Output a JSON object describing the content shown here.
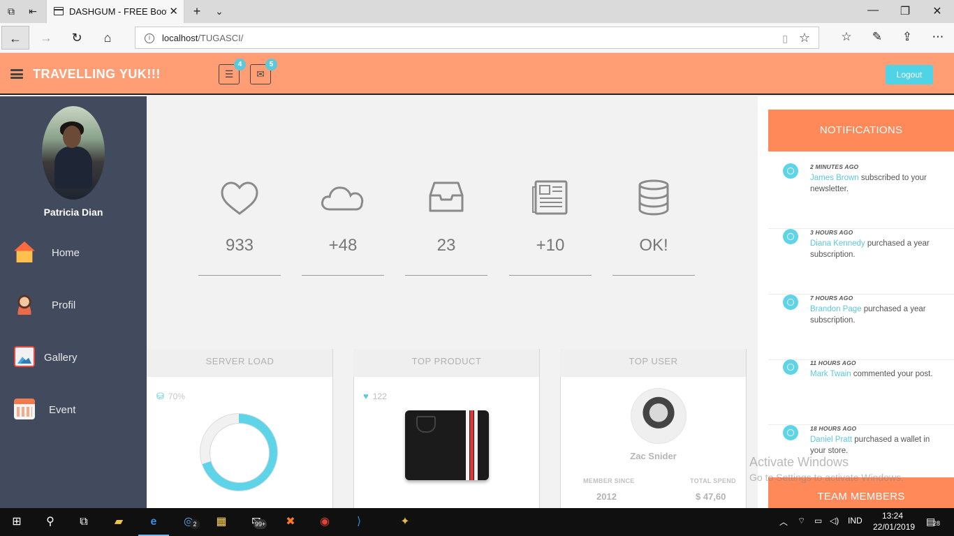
{
  "browser": {
    "tab_title": "DASHGUM - FREE Boot:",
    "url_host": "localhost",
    "url_path": "/TUGASCI/"
  },
  "header": {
    "brand": "TRAVELLING YUK!!!",
    "tasks_badge": "4",
    "mail_badge": "5",
    "logout_label": "Logout"
  },
  "sidebar": {
    "profile_name": "Patricia Dian",
    "items": [
      {
        "label": "Home",
        "icon": "home-icon"
      },
      {
        "label": "Profil",
        "icon": "person-icon"
      },
      {
        "label": "Gallery",
        "icon": "gallery-icon"
      },
      {
        "label": "Event",
        "icon": "calendar-icon"
      }
    ]
  },
  "stats": [
    {
      "icon": "heart-icon",
      "value": "933"
    },
    {
      "icon": "cloud-icon",
      "value": "+48"
    },
    {
      "icon": "inbox-icon",
      "value": "23"
    },
    {
      "icon": "newspaper-icon",
      "value": "+10"
    },
    {
      "icon": "database-icon",
      "value": "OK!"
    }
  ],
  "panels": {
    "server_load": {
      "title": "SERVER LOAD",
      "percent_label": "70%",
      "percent_value": 70
    },
    "top_product": {
      "title": "TOP PRODUCT",
      "likes": "122"
    },
    "top_user": {
      "title": "TOP USER",
      "name": "Zac Snider",
      "member_since_label": "MEMBER SINCE",
      "member_since_value": "2012",
      "total_spend_label": "TOTAL SPEND",
      "total_spend_value": "$ 47,60"
    }
  },
  "notifications": {
    "title": "NOTIFICATIONS",
    "items": [
      {
        "time": "2 MINUTES AGO",
        "who": "James Brown",
        "text": " subscribed to your newsletter."
      },
      {
        "time": "3 HOURS AGO",
        "who": "Diana Kennedy",
        "text": " purchased a year subscription."
      },
      {
        "time": "7 HOURS AGO",
        "who": "Brandon Page",
        "text": " purchased a year subscription."
      },
      {
        "time": "11 HOURS AGO",
        "who": "Mark Twain",
        "text": " commented your post."
      },
      {
        "time": "18 HOURS AGO",
        "who": "Daniel Pratt",
        "text": " purchased a wallet in your store."
      }
    ],
    "team_title": "TEAM MEMBERS"
  },
  "watermark": {
    "line1": "Activate Windows",
    "line2": "Go to Settings to activate Windows."
  },
  "taskbar": {
    "mail_badge": "2",
    "store_badge": "99+",
    "language": "IND",
    "time": "13:24",
    "date": "22/01/2019",
    "notification_count": "28"
  },
  "colors": {
    "header_bg": "#ff9e75",
    "sidebar_bg": "#424a5d",
    "accent": "#5ed4e8",
    "notif_header": "#ff8959"
  }
}
